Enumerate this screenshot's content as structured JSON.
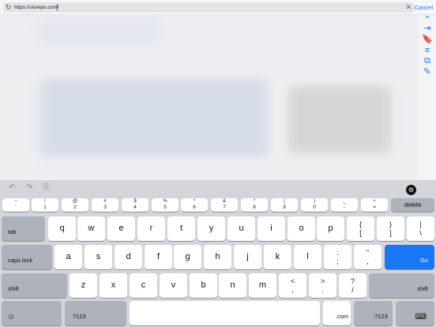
{
  "url_bar": {
    "url": "https://sisrepo.com/",
    "cancel_label": "Cancel"
  },
  "side_toolbar": [
    {
      "name": "chevron-up-icon",
      "glyph": "⌃"
    },
    {
      "name": "share-icon",
      "glyph": "⇥"
    },
    {
      "name": "bookmark-icon",
      "glyph": "🔖"
    },
    {
      "name": "reader-icon",
      "glyph": "≡"
    },
    {
      "name": "tabs-icon",
      "glyph": "⧉"
    },
    {
      "name": "compose-icon",
      "glyph": "✎"
    }
  ],
  "keyboard": {
    "assist": {
      "undo": "↶",
      "redo": "↷",
      "paste": "⎘",
      "settings": "⚙"
    },
    "number_row": [
      {
        "top": "~",
        "bottom": "`"
      },
      {
        "top": "!",
        "bottom": "1"
      },
      {
        "top": "@",
        "bottom": "2"
      },
      {
        "top": "#",
        "bottom": "3"
      },
      {
        "top": "$",
        "bottom": "4"
      },
      {
        "top": "%",
        "bottom": "5"
      },
      {
        "top": "^",
        "bottom": "6"
      },
      {
        "top": "&",
        "bottom": "7"
      },
      {
        "top": "*",
        "bottom": "8"
      },
      {
        "top": "(",
        "bottom": "9"
      },
      {
        "top": ")",
        "bottom": "0"
      },
      {
        "top": "_",
        "bottom": "-"
      },
      {
        "top": "+",
        "bottom": "="
      }
    ],
    "delete_label": "delete",
    "tab_label": "tab",
    "row1": [
      "q",
      "w",
      "e",
      "r",
      "t",
      "y",
      "u",
      "i",
      "o",
      "p"
    ],
    "row1_punct": [
      {
        "top": "{",
        "bottom": "["
      },
      {
        "top": "}",
        "bottom": "]"
      },
      {
        "top": "|",
        "bottom": "\\"
      }
    ],
    "capslock_label": "caps lock",
    "row2": [
      "a",
      "s",
      "d",
      "f",
      "g",
      "h",
      "j",
      "k",
      "l"
    ],
    "row2_punct": [
      {
        "top": ":",
        "bottom": ";"
      },
      {
        "top": "\"",
        "bottom": ","
      }
    ],
    "go_label": "Go",
    "shift_label": "shift",
    "row3": [
      "z",
      "x",
      "c",
      "v",
      "b",
      "n",
      "m"
    ],
    "row3_punct": [
      {
        "top": "<",
        "bottom": ","
      },
      {
        "top": ">",
        "bottom": "."
      },
      {
        "top": "?",
        "bottom": "/"
      }
    ],
    "emoji_glyph": "☺",
    "numbers_label": ".?123",
    "com_label": ".com",
    "hide_glyph": "⌨"
  }
}
